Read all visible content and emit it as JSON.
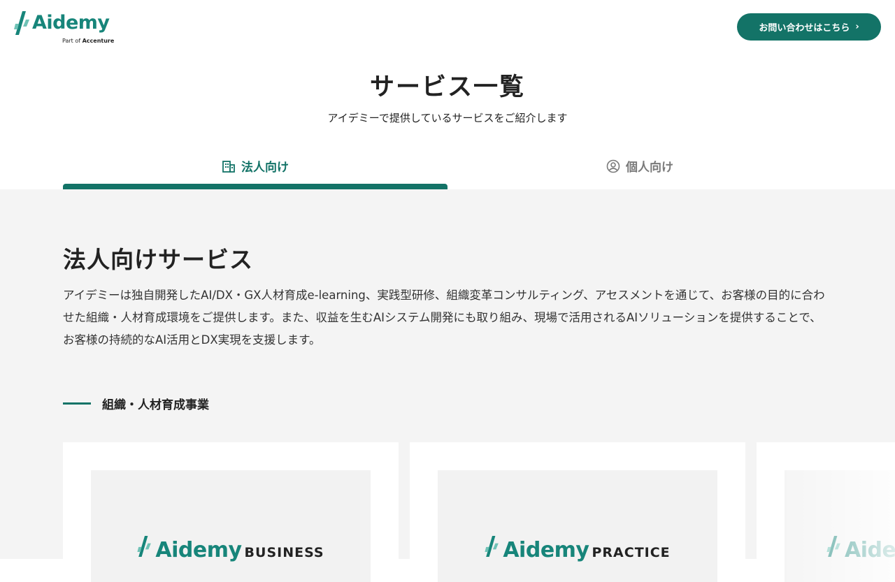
{
  "header": {
    "logo_text": "Aidemy",
    "logo_sub_prefix": "Part of ",
    "logo_sub_brand": "Accenture",
    "contact_label": "お問い合わせはこちら",
    "contact_chevron": "›"
  },
  "page": {
    "title": "サービス一覧",
    "subtitle": "アイデミーで提供しているサービスをご紹介します"
  },
  "tabs": [
    {
      "label": "法人向け",
      "icon": "building-icon",
      "active": true
    },
    {
      "label": "個人向け",
      "icon": "user-circle-icon",
      "active": false
    }
  ],
  "section": {
    "title": "法人向けサービス",
    "description": "アイデミーは独自開発したAI/DX・GX人材育成e-learning、実践型研修、組織変革コンサルティング、アセスメントを通じて、お客様の目的に合わせた組織・人材育成環境をご提供します。また、収益を生むAIシステム開発にも取り組み、現場で活用されるAIソリューションを提供することで、お客様の持続的なAI活用とDX実現を支援します。",
    "subheading": "組織・人材育成事業"
  },
  "cards": [
    {
      "brand": "Aidemy",
      "product": "BUSINESS"
    },
    {
      "brand": "Aidemy",
      "product": "PRACTICE"
    },
    {
      "brand": "Aide",
      "product": ""
    }
  ],
  "colors": {
    "accent": "#137367",
    "brand": "#17857a",
    "background_content": "#f4f4f4"
  }
}
